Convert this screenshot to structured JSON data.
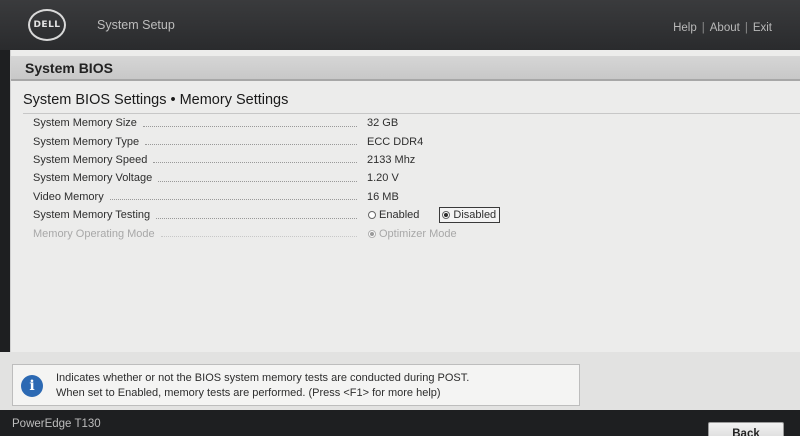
{
  "header": {
    "logo_text": "DELL",
    "app_title": "System Setup",
    "links": {
      "help": "Help",
      "about": "About",
      "exit": "Exit",
      "separator": "|"
    }
  },
  "section": {
    "title": "System BIOS"
  },
  "page": {
    "title": "System BIOS Settings • Memory Settings"
  },
  "settings": [
    {
      "label": "System Memory Size",
      "value": "32 GB"
    },
    {
      "label": "System Memory Type",
      "value": "ECC DDR4"
    },
    {
      "label": "System Memory Speed",
      "value": "2133 Mhz"
    },
    {
      "label": "System Memory Voltage",
      "value": "1.20 V"
    },
    {
      "label": "Video Memory",
      "value": "16 MB"
    },
    {
      "label": "System Memory Testing",
      "options": [
        "Enabled",
        "Disabled"
      ],
      "selected": "Disabled"
    },
    {
      "label": "Memory Operating Mode",
      "options": [
        "Optimizer Mode"
      ],
      "selected": "Optimizer Mode",
      "disabled": true
    }
  ],
  "help": {
    "icon": "info-icon",
    "line1": "Indicates whether or not the BIOS system memory tests are conducted during POST.",
    "line2": "When set to Enabled, memory tests are performed. (Press <F1> for more help)"
  },
  "footer": {
    "model": "PowerEdge T130",
    "back_label": "Back"
  },
  "colors": {
    "info_blue": "#2c69b3",
    "header_dark": "#2a2b2d",
    "panel_bg": "#ececeb"
  }
}
